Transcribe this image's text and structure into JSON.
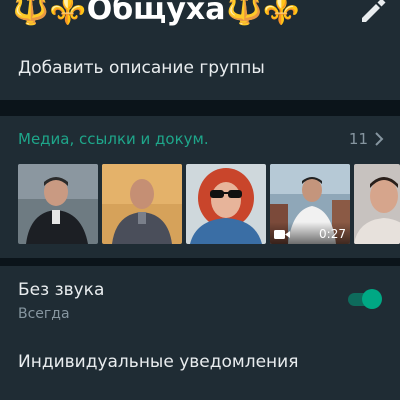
{
  "header": {
    "title": "🔱⚜️Общуха🔱⚜️",
    "edit_icon": "pencil-icon"
  },
  "description": {
    "text": "Добавить описание группы"
  },
  "media": {
    "label": "Медиа, ссылки и докум.",
    "count": "11",
    "chevron_icon": "chevron-right-icon",
    "thumbnails": [
      {
        "kind": "photo"
      },
      {
        "kind": "photo"
      },
      {
        "kind": "photo"
      },
      {
        "kind": "video",
        "duration": "0:27"
      },
      {
        "kind": "photo"
      }
    ]
  },
  "mute": {
    "title": "Без звука",
    "subtitle": "Всегда",
    "enabled": true
  },
  "notifications": {
    "title": "Индивидуальные уведомления"
  },
  "colors": {
    "background": "#0b141a",
    "panel": "#1f2c34",
    "accent": "#00a884",
    "accent_text": "#1ea68a",
    "secondary_text": "#8696a0"
  }
}
